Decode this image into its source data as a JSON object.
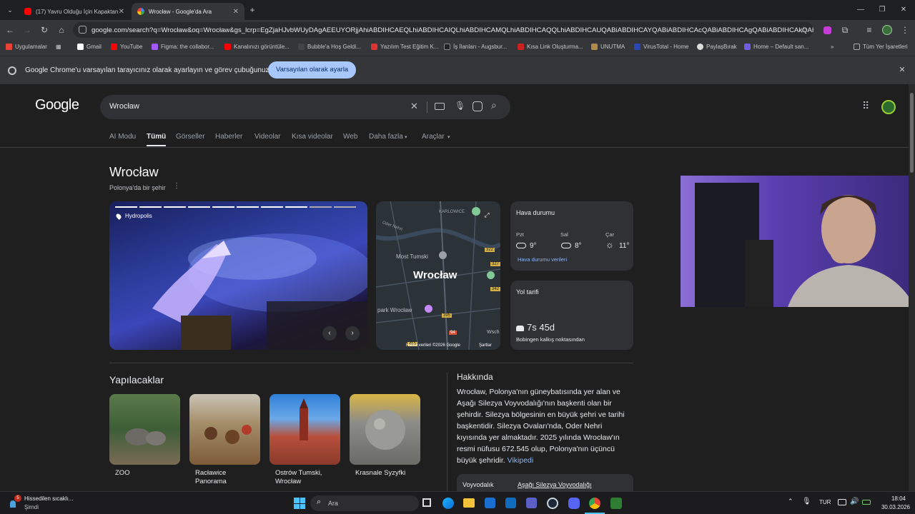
{
  "browser": {
    "tabs": [
      {
        "title": "(17) Yavru Olduğu İçin Kapaktan",
        "favicon": "youtube-icon"
      },
      {
        "title": "Wrocław - Google'da Ara",
        "favicon": "google-icon"
      }
    ],
    "new_tab_label": "+",
    "url": "google.com/search?q=Wrocław&oq=Wrocław&gs_lcrp=EgZjaHJvbWUyDAgAEEUYORjjAhiABDIHCAEQLhiABDIHCAIQLhiABDIHCAMQLhiABDIHCAQQLhiABDIHCAUQABiABDIHCAYQABiABDIHCAcQABiABDIHCAgQABiABDIHCAkQABiABNIB...",
    "bookmarks": [
      "Uygulamalar",
      "Gmail",
      "YouTube",
      "Figma: the collabor...",
      "Kanalınızı görüntüle...",
      "Bubble'a Hoş Geldi...",
      "Yazılım Test Eğitim K...",
      "İş İlanları - Augsbur...",
      "Kısa Link Oluşturma...",
      "UNUTMA",
      "VirusTotal - Home",
      "PaylaşBırak",
      "Home – Default san..."
    ],
    "bookmarks_overflow": "»",
    "all_bookmarks": "Tüm Yer İşaretleri",
    "infobar_text": "Google Chrome'u varsayılan tarayıcınız olarak ayarlayın ve görev çubuğunuza sabitleyin",
    "infobar_button": "Varsayılan olarak ayarla"
  },
  "google": {
    "logo": "Google",
    "query": "Wrocław",
    "nav": [
      "AI Modu",
      "Tümü",
      "Görseller",
      "Haberler",
      "Videolar",
      "Kısa videolar",
      "Web",
      "Daha fazla",
      "Araçlar"
    ],
    "active_nav": "Tümü",
    "entity_title": "Wrocław",
    "entity_subtitle": "Polonya'da bir şehir",
    "image_place": "Hydropolis",
    "map_city": "Wrocław",
    "map_labels": [
      "KARLOWICE",
      "Oder Nehri",
      "Most Tumski",
      "park Wrocław",
      "Wsch"
    ],
    "map_road_numbers": [
      "322",
      "327",
      "342",
      "395",
      "94",
      "455"
    ],
    "map_footer": "Harita verileri ©2026 Google",
    "map_terms": "Şartlar",
    "weather": {
      "title": "Hava durumu",
      "days": [
        {
          "day": "Pzt",
          "temp": "9°",
          "icon": "cloud-icon"
        },
        {
          "day": "Sal",
          "temp": "8°",
          "icon": "cloud-icon"
        },
        {
          "day": "Çar",
          "temp": "11°",
          "icon": "sun-icon"
        }
      ],
      "source": "Hava durumu verileri"
    },
    "route": {
      "title": "Yol tarifi",
      "time": "7s 45d",
      "from": "Bobingen kalkış noktasından"
    },
    "todo_title": "Yapılacaklar",
    "todo": [
      {
        "label": "ZOO"
      },
      {
        "label": "Racławice Panorama"
      },
      {
        "label": "Ostrów Tumski, Wrocław"
      },
      {
        "label": "Krasnale Syzyfki"
      }
    ],
    "about_title": "Hakkında",
    "about_text": "Wrocław, Polonya'nın güneybatısında yer alan ve Aşağı Silezya Voyvodalığı'nın başkenti olan bir şehirdir. Silezya bölgesinin en büyük şehri ve tarihi başkentidir. Silezya Ovaları'nda, Oder Nehri kıyısında yer almaktadır. 2025 yılında Wrocław'ın resmi nüfusu 672.545 olup, Polonya'nın üçüncü büyük şehridir.",
    "about_link": "Vikipedi",
    "voivodeship_key": "Voyvodalık",
    "voivodeship_value": "Aşağı Silezya Voyvodalığı"
  },
  "taskbar": {
    "notification_title": "Hissedilen sıcaklı...",
    "notification_sub": "Şimdi",
    "notification_badge": "5",
    "search_placeholder": "Ara",
    "lang": "TUR",
    "time": "18:04",
    "date": "30.03.2026"
  },
  "colors": {
    "accent": "#8ab4f8",
    "infobar_button": "#a8c7fa",
    "youtube": "#ff0000"
  }
}
